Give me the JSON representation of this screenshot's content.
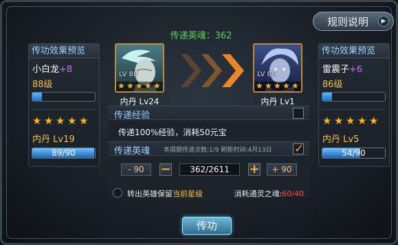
{
  "header": {
    "rules_label": "规则说明",
    "transfer_souls": "传递英魂：362"
  },
  "left_panel": {
    "title": "传功效果预览",
    "hero_name": "小白龙",
    "hero_plus": "+8",
    "level": "88级",
    "exp_progress": 0.15,
    "stars": 5,
    "dan_label": "内丹 Lv19",
    "dan_value": "89/90",
    "dan_progress": 0.99
  },
  "right_panel": {
    "title": "传功效果预览",
    "hero_name": "雷震子",
    "hero_plus": "+6",
    "level": "86级",
    "exp_progress": 0.15,
    "stars": 5,
    "dan_label": "内丹 Lv5",
    "dan_value": "54/90",
    "dan_progress": 0.6
  },
  "source_hero": {
    "level": "LV 88",
    "dan": "内丹 Lv24",
    "stars": 5
  },
  "target_hero": {
    "level": "LV 86",
    "dan": "内丹 Lv1",
    "stars": 5
  },
  "exp_section": {
    "title": "传递经验",
    "checked": false,
    "description": "传递100%经验，消耗50元宝"
  },
  "soul_section": {
    "title": "传递英魂",
    "info": "本周期传递次数:1/9 刷新时间:4月13日",
    "checked": true,
    "minus_label": "- 90",
    "plus_label": "+ 90",
    "minus_icon": "−",
    "plus_icon": "+",
    "value": "362/2611"
  },
  "footer_row": {
    "keep_text": "转出英雄保留",
    "keep_highlight": "当前星级",
    "consume_text": "消耗通灵之魂:",
    "consume_value": "60/40"
  },
  "submit_label": "传功",
  "icons": {
    "star": "★",
    "tick": "✓",
    "arrow": "▶"
  },
  "colors": {
    "accent_green": "#5fd45a",
    "panel_title": "#9fd3ff",
    "gold": "#f3c24e",
    "warning": "#ff4a4a"
  }
}
